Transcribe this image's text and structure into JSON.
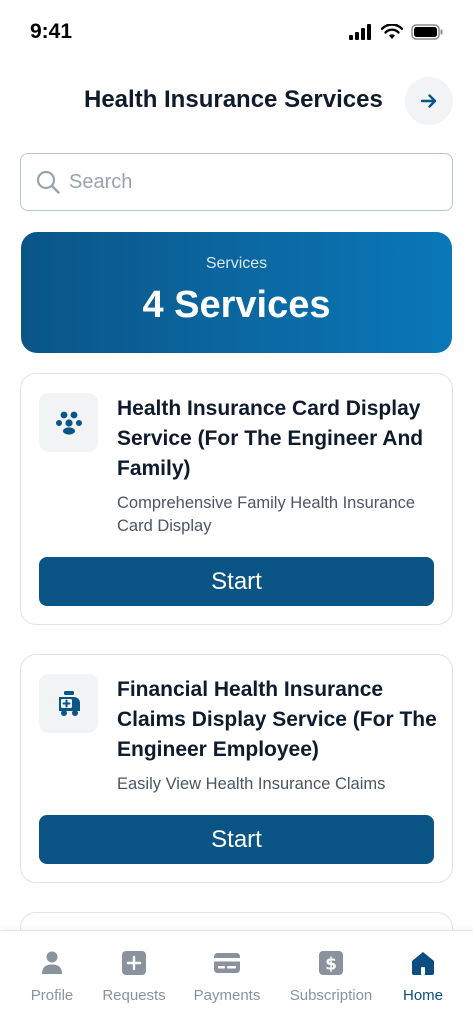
{
  "status_bar": {
    "time": "9:41"
  },
  "header": {
    "title": "Health Insurance Services"
  },
  "search": {
    "placeholder": "Search",
    "value": ""
  },
  "banner": {
    "label": "Services",
    "count": "4 Services"
  },
  "services": [
    {
      "title": "Health Insurance Card Display Service (For The Engineer And Family)",
      "description": "Comprehensive Family Health Insurance Card Display",
      "button_label": "Start",
      "icon": "family-icon"
    },
    {
      "title": "Financial Health Insurance Claims Display Service (For The Engineer Employee)",
      "description": "Easily View Health Insurance Claims",
      "button_label": "Start",
      "icon": "ambulance-icon"
    }
  ],
  "bottom_nav": {
    "items": [
      {
        "label": "Profile",
        "icon": "person-icon"
      },
      {
        "label": "Requests",
        "icon": "plus-square-icon"
      },
      {
        "label": "Payments",
        "icon": "card-icon"
      },
      {
        "label": "Subscription",
        "icon": "dollar-icon"
      },
      {
        "label": "Home",
        "icon": "home-icon",
        "active": true
      }
    ]
  },
  "colors": {
    "primary": "#0a5585",
    "banner_start": "#0a5588",
    "banner_end": "#0977b8",
    "nav_inactive": "#8a939d",
    "nav_active": "#0a4f80"
  }
}
